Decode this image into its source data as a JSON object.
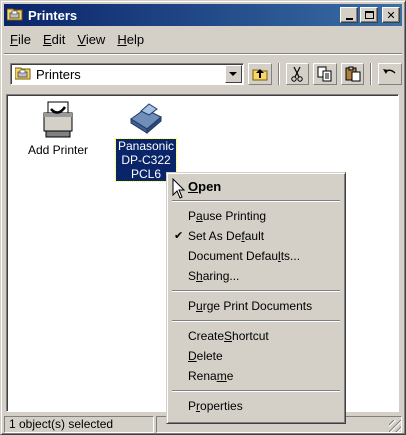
{
  "window": {
    "title": "Printers"
  },
  "menubar": {
    "items": [
      {
        "label": "File",
        "accel": "F",
        "rest": "ile"
      },
      {
        "label": "Edit",
        "accel": "E",
        "rest": "dit"
      },
      {
        "label": "View",
        "accel": "V",
        "rest": "iew"
      },
      {
        "label": "Help",
        "accel": "H",
        "rest": "elp"
      }
    ]
  },
  "address": {
    "value": "Printers"
  },
  "icons": {
    "add_printer": {
      "label": "Add Printer"
    },
    "panasonic": {
      "line1": "Panasonic",
      "line2": "DP-C322",
      "line3": "PCL6"
    }
  },
  "status": {
    "text": "1 object(s) selected"
  },
  "context_menu": {
    "open": {
      "pre": "",
      "accel": "O",
      "post": "pen"
    },
    "pause": {
      "pre": "P",
      "accel": "a",
      "post": "use Printing"
    },
    "set_default": {
      "pre": "Set As De",
      "accel": "f",
      "post": "ault"
    },
    "doc_defaults": {
      "pre": "Document Defau",
      "accel": "l",
      "post": "ts..."
    },
    "sharing": {
      "pre": "S",
      "accel": "h",
      "post": "aring..."
    },
    "purge": {
      "pre": "P",
      "accel": "u",
      "post": "rge Print Documents"
    },
    "shortcut": {
      "pre": "Create ",
      "accel": "S",
      "post": "hortcut"
    },
    "delete": {
      "pre": "",
      "accel": "D",
      "post": "elete"
    },
    "rename": {
      "pre": "Rena",
      "accel": "m",
      "post": "e"
    },
    "properties": {
      "pre": "P",
      "accel": "r",
      "post": "operties"
    }
  },
  "colors": {
    "title_start": "#0a246a",
    "title_end": "#3a6ea5",
    "face": "#d4d0c8",
    "selection": "#0a246a"
  }
}
